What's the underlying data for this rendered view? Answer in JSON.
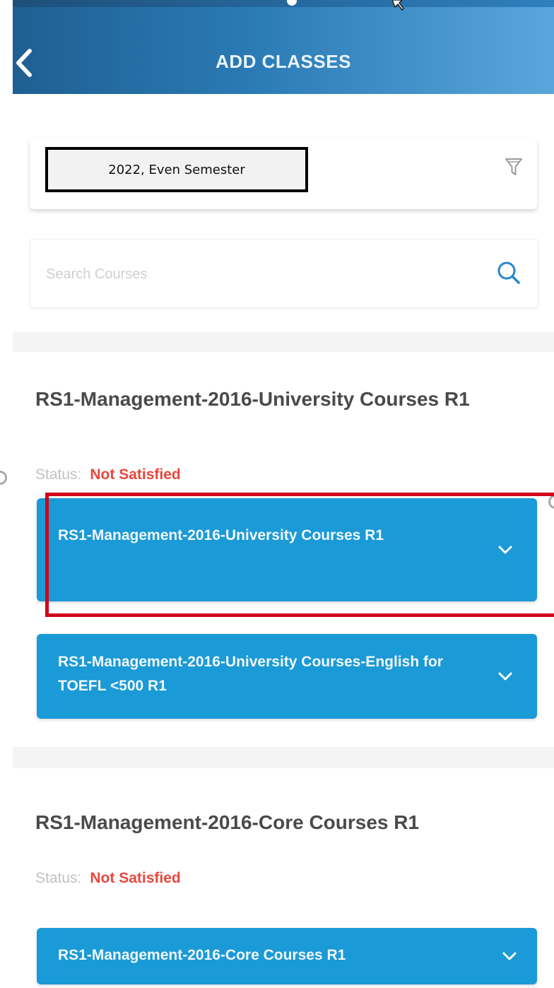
{
  "header": {
    "title": "ADD CLASSES",
    "back_icon": "chevron-left-icon",
    "gradient_colors": [
      "#1f5f92",
      "#5aa6dc"
    ]
  },
  "semester": {
    "value": "2022, Even Semester",
    "filter_icon": "filter-icon"
  },
  "search": {
    "placeholder": "Search Courses",
    "icon": "search-icon"
  },
  "groups": [
    {
      "title": "RS1-Management-2016-University Courses R1",
      "status_label": "Status:",
      "status_value": "Not Satisfied",
      "items": [
        {
          "label": "RS1-Management-2016-University Courses R1"
        },
        {
          "label": "RS1-Management-2016-University Courses-English for TOEFL <500 R1"
        }
      ]
    },
    {
      "title": "RS1-Management-2016-Core Courses R1",
      "status_label": "Status:",
      "status_value": "Not Satisfied",
      "items": [
        {
          "label": "RS1-Management-2016-Core Courses R1"
        }
      ]
    }
  ],
  "colors": {
    "item_background": "#1a9ad6",
    "status_not_satisfied": "#e8473c",
    "highlight": "#d0021b"
  }
}
